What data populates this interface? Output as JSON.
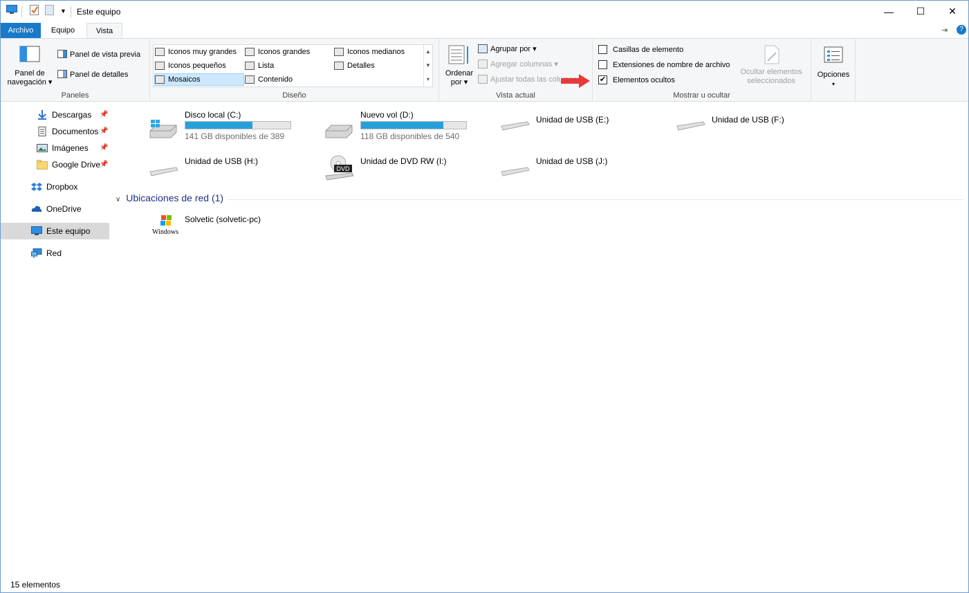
{
  "window": {
    "title": "Este equipo",
    "minimize": "—",
    "maximize": "☐",
    "close": "✕"
  },
  "tabs": {
    "file": "Archivo",
    "equipo": "Equipo",
    "vista": "Vista"
  },
  "ribbon": {
    "paneles": {
      "label": "Paneles",
      "nav_pane": "Panel de navegación",
      "nav_pane_line1": "Panel de",
      "nav_pane_line2": "navegación",
      "preview": "Panel de vista previa",
      "details": "Panel de detalles"
    },
    "diseno": {
      "label": "Diseño",
      "items": [
        "Iconos muy grandes",
        "Iconos grandes",
        "Iconos medianos",
        "Iconos pequeños",
        "Lista",
        "Detalles",
        "Mosaicos",
        "Contenido"
      ]
    },
    "vista_actual": {
      "label": "Vista actual",
      "ordenar_line1": "Ordenar",
      "ordenar_line2": "por",
      "agrupar": "Agrupar por",
      "agregar": "Agregar columnas",
      "ajustar": "Ajustar todas las columnas"
    },
    "mostrar": {
      "label": "Mostrar u ocultar",
      "casillas": "Casillas de elemento",
      "extensiones": "Extensiones de nombre de archivo",
      "ocultos": "Elementos ocultos",
      "ocultos_checked": true,
      "ocultar_line1": "Ocultar elementos",
      "ocultar_line2": "seleccionados"
    },
    "opciones": "Opciones"
  },
  "sidebar": {
    "items": [
      {
        "label": "Descargas",
        "icon": "download-icon",
        "pinned": true
      },
      {
        "label": "Documentos",
        "icon": "document-icon",
        "pinned": true
      },
      {
        "label": "Imágenes",
        "icon": "image-icon",
        "pinned": true
      },
      {
        "label": "Google Drive",
        "icon": "folder-icon",
        "pinned": true
      },
      {
        "label": "Dropbox",
        "icon": "dropbox-icon"
      },
      {
        "label": "OneDrive",
        "icon": "cloud-icon"
      },
      {
        "label": "Este equipo",
        "icon": "computer-icon",
        "selected": true
      },
      {
        "label": "Red",
        "icon": "network-icon"
      }
    ]
  },
  "drives": [
    {
      "name": "Disco local (C:)",
      "free": "141 GB disponibles de 389",
      "used_fraction": 0.64
    },
    {
      "name": "Nuevo vol (D:)",
      "free": "118 GB disponibles de 540",
      "used_fraction": 0.78
    },
    {
      "name": "Unidad de USB (E:)"
    },
    {
      "name": "Unidad de USB (F:)"
    },
    {
      "name": "Unidad de USB (H:)"
    },
    {
      "name": "Unidad de DVD RW (I:)"
    },
    {
      "name": "Unidad de USB (J:)"
    }
  ],
  "network": {
    "section": "Ubicaciones de red (1)",
    "item": "Solvetic (solvetic-pc)",
    "logo_text": "Windows"
  },
  "status": {
    "count": "15 elementos"
  },
  "colors": {
    "accent": "#1979ca",
    "bar_fill": "#26a0da",
    "section": "#1e3287",
    "selected": "#cce8ff"
  }
}
